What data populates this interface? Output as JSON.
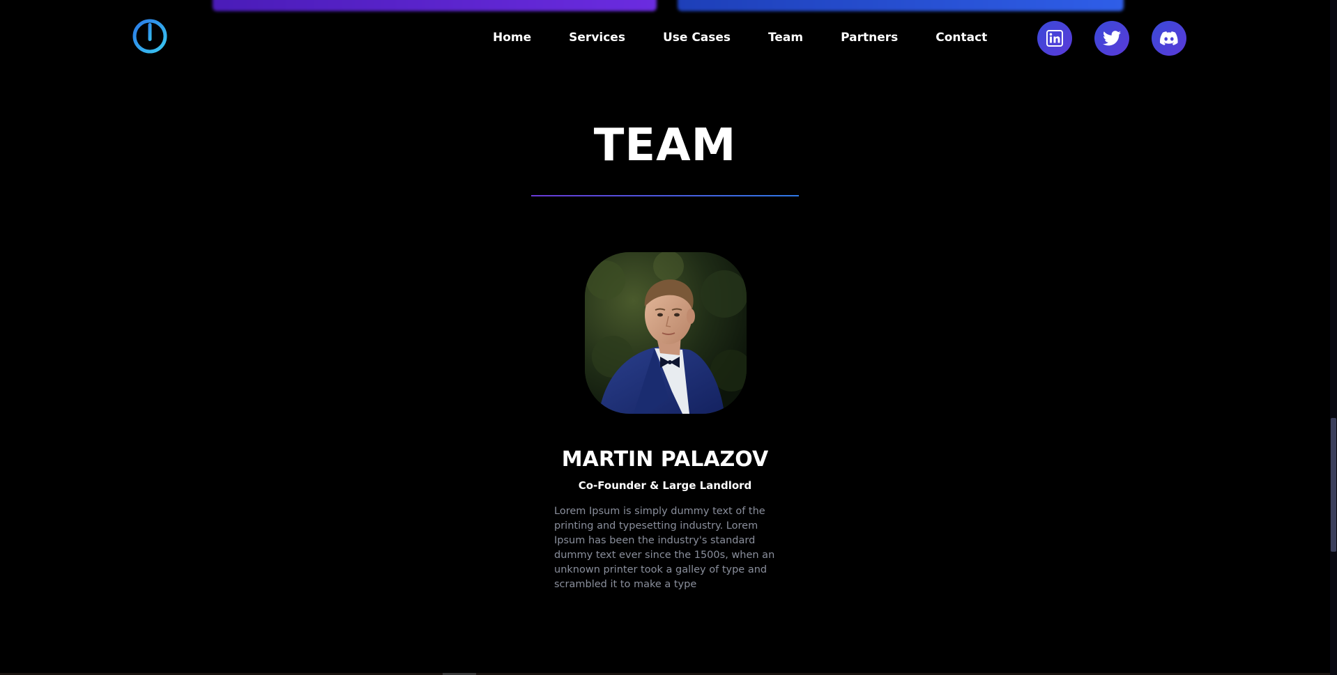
{
  "header": {
    "logo_icon": "power-ring-logo",
    "nav": [
      {
        "label": "Home"
      },
      {
        "label": "Services"
      },
      {
        "label": "Use Cases"
      },
      {
        "label": "Team"
      },
      {
        "label": "Partners"
      },
      {
        "label": "Contact"
      }
    ],
    "socials": [
      {
        "icon": "linkedin-icon"
      },
      {
        "icon": "twitter-icon"
      },
      {
        "icon": "discord-icon"
      }
    ]
  },
  "section": {
    "title": "TEAM"
  },
  "member": {
    "name": "MARTIN PALAZOV",
    "role": "Co-Founder & Large Landlord",
    "bio": "Lorem Ipsum is simply dummy text of the printing and typesetting industry. Lorem Ipsum has been the industry's standard dummy text ever since the 1500s, when an unknown printer took a galley of type and scrambled it to make a type"
  },
  "colors": {
    "background": "#000000",
    "accent_purple": "#6a3ad8",
    "accent_blue": "#2f7ae8",
    "bio_text": "#8a8f9c"
  }
}
